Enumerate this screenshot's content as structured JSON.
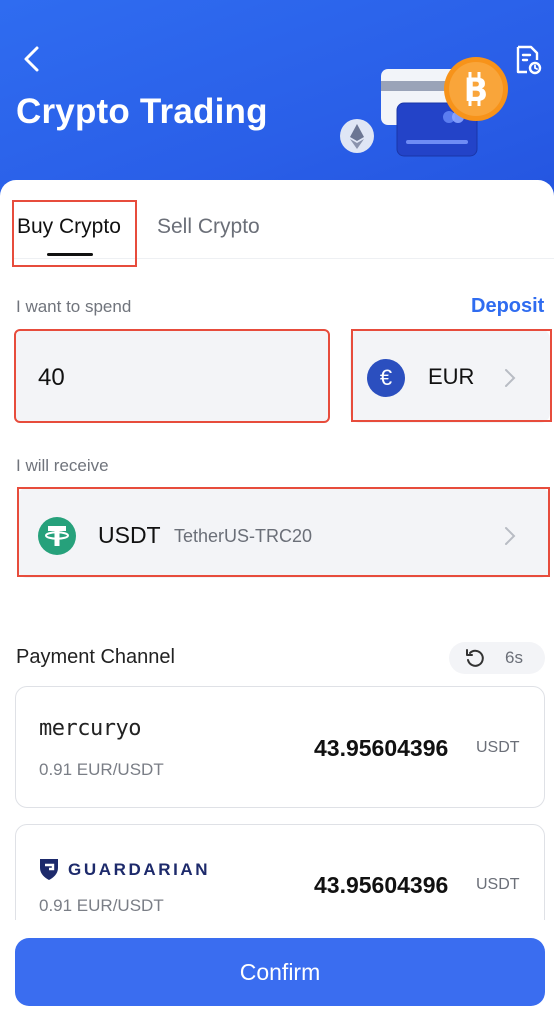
{
  "header": {
    "title": "Crypto Trading"
  },
  "tabs": [
    {
      "label": "Buy Crypto",
      "active": true
    },
    {
      "label": "Sell Crypto",
      "active": false
    }
  ],
  "spend": {
    "label": "I want to spend",
    "deposit_link": "Deposit",
    "amount": "40",
    "currency_symbol": "€",
    "currency": "EUR"
  },
  "receive": {
    "label": "I will receive",
    "coin": "USDT",
    "network": "TetherUS-TRC20"
  },
  "payment": {
    "title": "Payment Channel",
    "refresh_seconds": "6s",
    "channels": [
      {
        "name": "mercuryo",
        "rate": "0.91 EUR/USDT",
        "amount": "43.95604396",
        "unit": "USDT"
      },
      {
        "name": "GUARDARIAN",
        "rate": "0.91 EUR/USDT",
        "amount": "43.95604396",
        "unit": "USDT"
      }
    ]
  },
  "confirm_label": "Confirm",
  "colors": {
    "brand_blue": "#2f6cf0",
    "highlight_red": "#e74c3c",
    "tether_green": "#26a17b",
    "bitcoin_orange": "#f7931a"
  },
  "icons": [
    "back-arrow-icon",
    "document-settings-icon",
    "bitcoin-icon",
    "ethereum-icon",
    "euro-icon",
    "tether-icon",
    "chevron-right-icon",
    "refresh-icon",
    "guardarian-logo-icon"
  ]
}
